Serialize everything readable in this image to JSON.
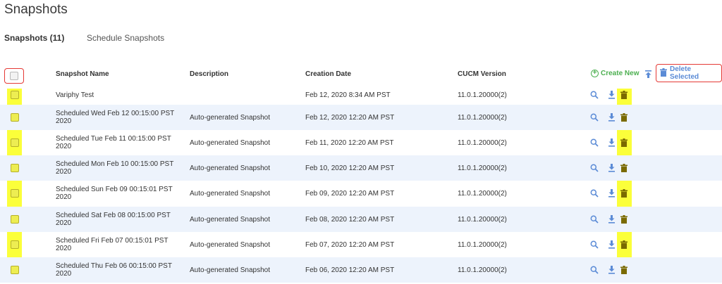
{
  "page": {
    "title": "Snapshots"
  },
  "tabs": [
    {
      "label": "Snapshots (11)",
      "active": true
    },
    {
      "label": "Schedule Snapshots",
      "active": false
    }
  ],
  "table": {
    "headers": {
      "name": "Snapshot Name",
      "description": "Description",
      "creation_date": "Creation Date",
      "cucm_version": "CUCM Version"
    },
    "rows": [
      {
        "name": "Variphy Test",
        "description": "",
        "date": "Feb 12, 2020 8:34 AM PST",
        "version": "11.0.1.20000(2)"
      },
      {
        "name": "Scheduled Wed Feb 12 00:15:00 PST 2020",
        "description": "Auto-generated Snapshot",
        "date": "Feb 12, 2020 12:20 AM PST",
        "version": "11.0.1.20000(2)"
      },
      {
        "name": "Scheduled Tue Feb 11 00:15:00 PST 2020",
        "description": "Auto-generated Snapshot",
        "date": "Feb 11, 2020 12:20 AM PST",
        "version": "11.0.1.20000(2)"
      },
      {
        "name": "Scheduled Mon Feb 10 00:15:00 PST 2020",
        "description": "Auto-generated Snapshot",
        "date": "Feb 10, 2020 12:20 AM PST",
        "version": "11.0.1.20000(2)"
      },
      {
        "name": "Scheduled Sun Feb 09 00:15:01 PST 2020",
        "description": "Auto-generated Snapshot",
        "date": "Feb 09, 2020 12:20 AM PST",
        "version": "11.0.1.20000(2)"
      },
      {
        "name": "Scheduled Sat Feb 08 00:15:00 PST 2020",
        "description": "Auto-generated Snapshot",
        "date": "Feb 08, 2020 12:20 AM PST",
        "version": "11.0.1.20000(2)"
      },
      {
        "name": "Scheduled Fri Feb 07 00:15:01 PST 2020",
        "description": "Auto-generated Snapshot",
        "date": "Feb 07, 2020 12:20 AM PST",
        "version": "11.0.1.20000(2)"
      },
      {
        "name": "Scheduled Thu Feb 06 00:15:00 PST 2020",
        "description": "Auto-generated Snapshot",
        "date": "Feb 06, 2020 12:20 AM PST",
        "version": "11.0.1.20000(2)"
      }
    ]
  },
  "actions": {
    "create_new": "Create New",
    "delete_selected": "Delete Selected",
    "row_icons": [
      "search-icon",
      "download-icon",
      "trash-icon"
    ]
  },
  "colors": {
    "accent_blue": "#5b8bd6",
    "create_green": "#4caf50",
    "highlight_yellow": "#fbff3a",
    "annotation_red": "#e53935",
    "row_shade": "#edf3fc",
    "trash": "#7a6a00"
  }
}
